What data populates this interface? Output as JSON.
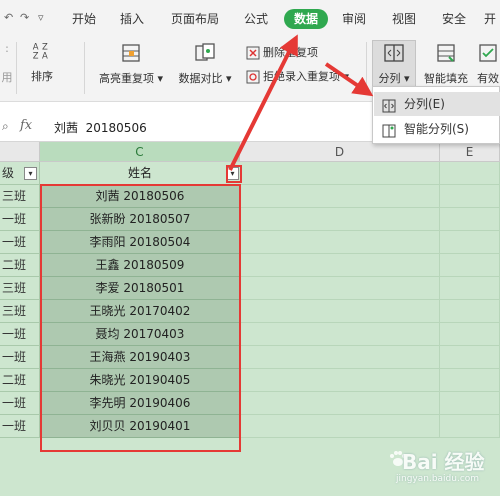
{
  "menubar": {
    "tabs": [
      {
        "label": "开始",
        "active": false
      },
      {
        "label": "插入",
        "active": false
      },
      {
        "label": "页面布局",
        "active": false
      },
      {
        "label": "公式",
        "active": false
      },
      {
        "label": "数据",
        "active": true
      },
      {
        "label": "审阅",
        "active": false
      },
      {
        "label": "视图",
        "active": false
      },
      {
        "label": "安全",
        "active": false
      },
      {
        "label": "开",
        "active": false
      }
    ],
    "accent": "#2fa84f"
  },
  "ribbon": {
    "sort_label": "排序",
    "highlight_dup_label": "高亮重复项",
    "compare_label": "数据对比",
    "delete_dup_label": "删除重复项",
    "reject_dup_label": "拒绝录入重复项",
    "split_label": "分列",
    "smart_fill_label": "智能填充",
    "valid_label": "有效"
  },
  "dropdown": {
    "items": [
      {
        "label": "分列(E)",
        "icon": "split-column-icon"
      },
      {
        "label": "智能分列(S)",
        "icon": "smart-split-icon"
      }
    ]
  },
  "formulabar": {
    "fx": "fx",
    "value": "刘茜  20180506"
  },
  "grid": {
    "columns": [
      "C",
      "D",
      "E"
    ],
    "header_row": {
      "class_label": "级",
      "name_label": "姓名"
    },
    "rows": [
      {
        "cls": "三班",
        "name": "刘茜  20180506"
      },
      {
        "cls": "一班",
        "name": "张新盼  20180507"
      },
      {
        "cls": "一班",
        "name": "李雨阳  20180504"
      },
      {
        "cls": "二班",
        "name": "王鑫  20180509"
      },
      {
        "cls": "三班",
        "name": "李爱  20180501"
      },
      {
        "cls": "三班",
        "name": "王晓光  20170402"
      },
      {
        "cls": "一班",
        "name": "聂均  20170403"
      },
      {
        "cls": "一班",
        "name": "王海燕  20190403"
      },
      {
        "cls": "二班",
        "name": "朱晓光  20190405"
      },
      {
        "cls": "一班",
        "name": "李先明  20190406"
      },
      {
        "cls": "一班",
        "name": "刘贝贝  20190401"
      }
    ],
    "highlight_color": "#e53935"
  },
  "watermark": {
    "main": "Bai 经验",
    "sub": "jingyan.baidu.com"
  }
}
